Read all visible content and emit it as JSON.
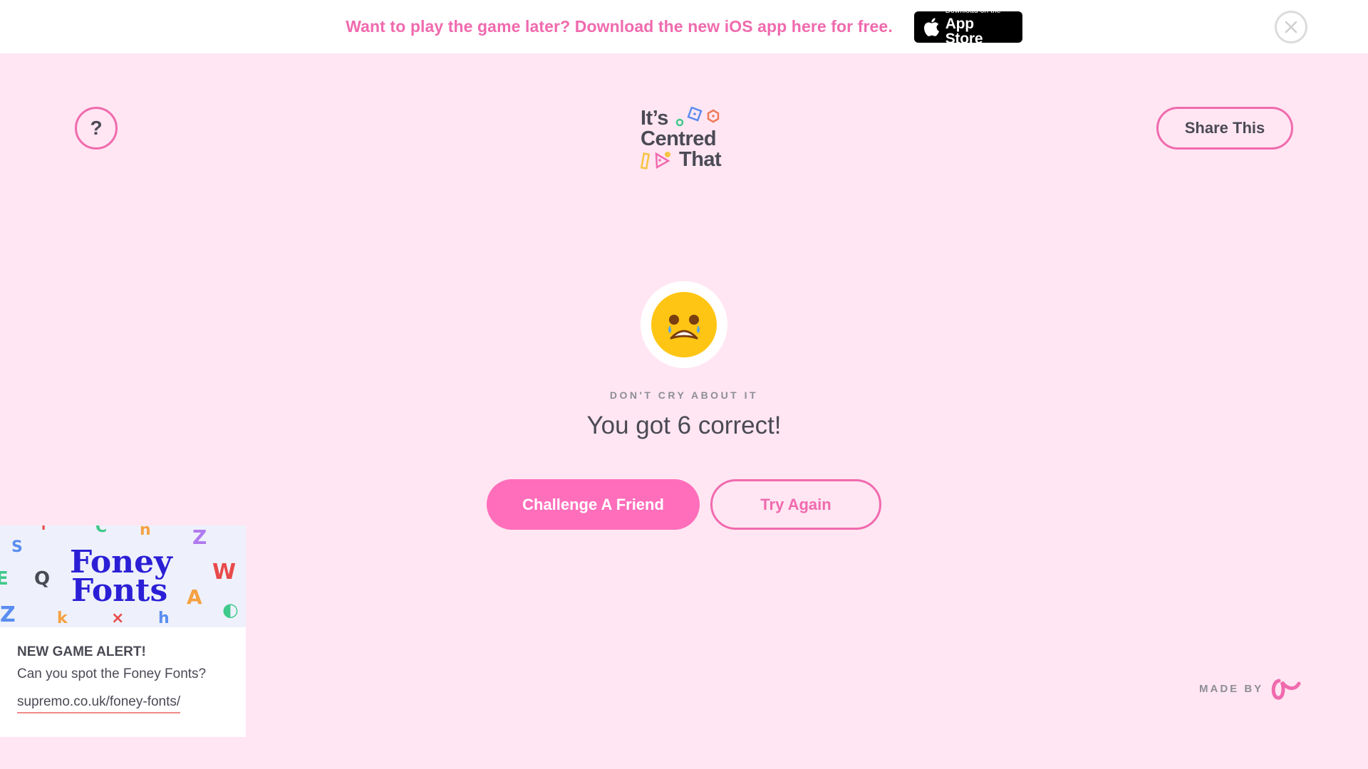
{
  "banner": {
    "text": "Want to play the game later? Download the new iOS app here for free.",
    "badge_small": "Download on the",
    "badge_big": "App Store"
  },
  "header": {
    "help_label": "?",
    "share_label": "Share This"
  },
  "logo": {
    "line1": "It’s",
    "line2": "Centred",
    "line3": "That"
  },
  "result": {
    "subheading": "DON'T CRY ABOUT IT",
    "score_text": "You got 6 correct!",
    "challenge_label": "Challenge A Friend",
    "try_again_label": "Try Again"
  },
  "promo": {
    "image_title_1": "Foney",
    "image_title_2": "Fonts",
    "heading": "NEW GAME ALERT!",
    "description": "Can you spot the Foney Fonts?",
    "link": "supremo.co.uk/foney-fonts/"
  },
  "footer": {
    "made_by": "MADE BY"
  },
  "colors": {
    "background": "#ffe6f2",
    "accent_pink": "#f06aae",
    "button_pink": "#ff6ebb",
    "text_dark": "#4a4a55",
    "muted": "#8d8d96"
  },
  "icons": [
    "apple-icon",
    "close-icon",
    "crying-face-icon",
    "maker-logo-icon"
  ]
}
